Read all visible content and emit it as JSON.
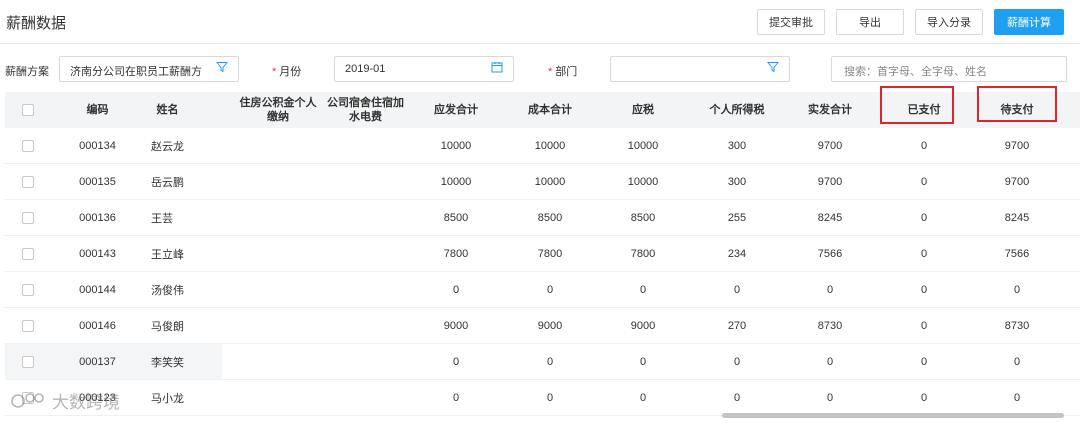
{
  "header": {
    "title": "薪酬数据",
    "buttons": {
      "submit_review": "提交审批",
      "export": "导出",
      "import_entries": "导入分录",
      "calculate": "薪酬计算"
    }
  },
  "filters": {
    "plan_label": "薪酬方案",
    "plan_value": "济南分公司在职员工薪酬方",
    "month_label": "月份",
    "month_value": "2019-01",
    "dept_label": "部门",
    "dept_value": "",
    "search_placeholder": "搜索：首字母、全字母、姓名"
  },
  "table": {
    "headers": {
      "code": "编码",
      "name": "姓名",
      "housing_fund_1": "住房公积金个人",
      "housing_fund_2": "缴纳",
      "dorm_1": "公司宿舍住宿加",
      "dorm_2": "水电费",
      "gross": "应发合计",
      "cost": "成本合计",
      "taxable": "应税",
      "income_tax": "个人所得税",
      "net": "实发合计",
      "paid": "已支付",
      "pending": "待支付"
    },
    "rows": [
      {
        "code": "000134",
        "name": "赵云龙",
        "housing": "",
        "dorm": "",
        "gross": "10000",
        "cost": "10000",
        "taxable": "10000",
        "tax": "300",
        "net": "9700",
        "paid": "0",
        "pending": "9700"
      },
      {
        "code": "000135",
        "name": "岳云鹏",
        "housing": "",
        "dorm": "",
        "gross": "10000",
        "cost": "10000",
        "taxable": "10000",
        "tax": "300",
        "net": "9700",
        "paid": "0",
        "pending": "9700"
      },
      {
        "code": "000136",
        "name": "王芸",
        "housing": "",
        "dorm": "",
        "gross": "8500",
        "cost": "8500",
        "taxable": "8500",
        "tax": "255",
        "net": "8245",
        "paid": "0",
        "pending": "8245"
      },
      {
        "code": "000143",
        "name": "王立峰",
        "housing": "",
        "dorm": "",
        "gross": "7800",
        "cost": "7800",
        "taxable": "7800",
        "tax": "234",
        "net": "7566",
        "paid": "0",
        "pending": "7566"
      },
      {
        "code": "000144",
        "name": "汤俊伟",
        "housing": "",
        "dorm": "",
        "gross": "0",
        "cost": "0",
        "taxable": "0",
        "tax": "0",
        "net": "0",
        "paid": "0",
        "pending": "0"
      },
      {
        "code": "000146",
        "name": "马俊朗",
        "housing": "",
        "dorm": "",
        "gross": "9000",
        "cost": "9000",
        "taxable": "9000",
        "tax": "270",
        "net": "8730",
        "paid": "0",
        "pending": "8730"
      },
      {
        "code": "000137",
        "name": "李笑笑",
        "housing": "",
        "dorm": "",
        "gross": "0",
        "cost": "0",
        "taxable": "0",
        "tax": "0",
        "net": "0",
        "paid": "0",
        "pending": "0"
      },
      {
        "code": "000123",
        "name": "马小龙",
        "housing": "",
        "dorm": "",
        "gross": "0",
        "cost": "0",
        "taxable": "0",
        "tax": "0",
        "net": "0",
        "paid": "0",
        "pending": "0"
      }
    ]
  },
  "watermark": "大数跨境",
  "colors": {
    "primary": "#1e9ff2",
    "highlight": "#e0242b",
    "header_bg": "#f2f4f6"
  }
}
